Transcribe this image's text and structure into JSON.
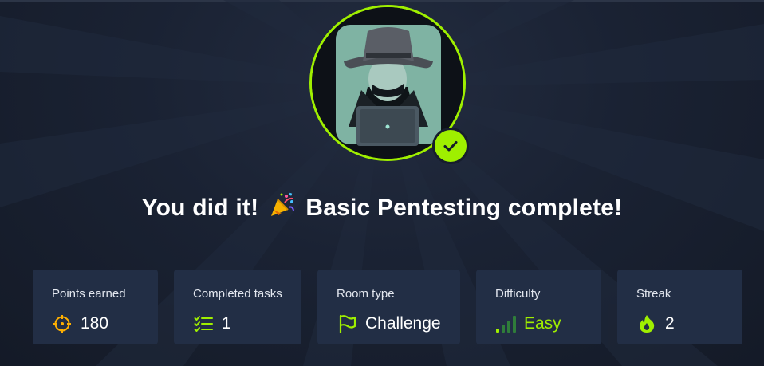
{
  "colors": {
    "accent": "#9fef00",
    "card_bg": "#222e45",
    "page_bg": "#161d2c",
    "icon_orange": "#ffaf00"
  },
  "avatar": {
    "icon": "hacker-avatar-icon",
    "badge_icon": "checkmark-icon"
  },
  "headline": {
    "before": "You did it!",
    "emoji": "party-popper-icon",
    "after": "Basic Pentesting complete!"
  },
  "stats": [
    {
      "label": "Points earned",
      "value": "180",
      "icon": "target-icon"
    },
    {
      "label": "Completed tasks",
      "value": "1",
      "icon": "checklist-icon"
    },
    {
      "label": "Room type",
      "value": "Challenge",
      "icon": "flag-icon"
    },
    {
      "label": "Difficulty",
      "value": "Easy",
      "icon": "signal-bars-icon",
      "level": "1 of 4"
    },
    {
      "label": "Streak",
      "value": "2",
      "icon": "flame-icon"
    }
  ]
}
